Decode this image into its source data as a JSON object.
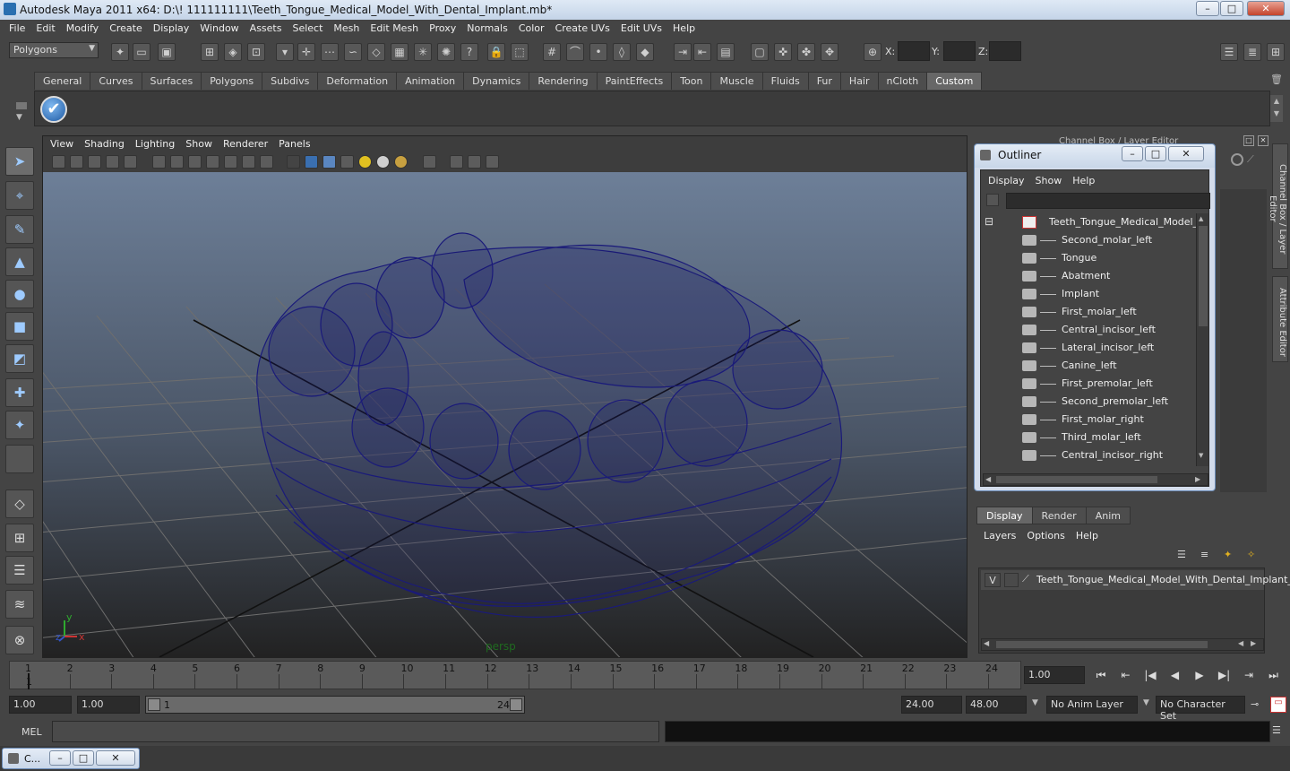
{
  "window": {
    "title": "Autodesk Maya 2011 x64: D:\\! 111111111\\Teeth_Tongue_Medical_Model_With_Dental_Implant.mb*",
    "minimize": "–",
    "maximize": "□",
    "close": "✕"
  },
  "menus": [
    "File",
    "Edit",
    "Modify",
    "Create",
    "Display",
    "Window",
    "Assets",
    "Select",
    "Mesh",
    "Edit Mesh",
    "Proxy",
    "Normals",
    "Color",
    "Create UVs",
    "Edit UVs",
    "Help"
  ],
  "status_line": {
    "mode": "Polygons",
    "x_label": "X:",
    "y_label": "Y:",
    "z_label": "Z:"
  },
  "shelf": {
    "tabs": [
      "General",
      "Curves",
      "Surfaces",
      "Polygons",
      "Subdivs",
      "Deformation",
      "Animation",
      "Dynamics",
      "Rendering",
      "PaintEffects",
      "Toon",
      "Muscle",
      "Fluids",
      "Fur",
      "Hair",
      "nCloth",
      "Custom"
    ],
    "active_tab": "Custom",
    "check_icon": "✔"
  },
  "viewport": {
    "menus": [
      "View",
      "Shading",
      "Lighting",
      "Show",
      "Renderer",
      "Panels"
    ],
    "camera_label": "persp",
    "axis_x": "x",
    "axis_y": "y",
    "axis_z": "z",
    "wire_color": "#1a1a7a"
  },
  "channel_box": {
    "title": "Channel Box / Layer Editor",
    "side_tab_1": "Channel Box / Layer Editor",
    "side_tab_2": "Attribute Editor"
  },
  "outliner": {
    "title": "Outliner",
    "menus": [
      "Display",
      "Show",
      "Help"
    ],
    "root": "Teeth_Tongue_Medical_Model_Wit",
    "collapse_symbol": "⊟",
    "items": [
      "Second_molar_left",
      "Tongue",
      "Abatment",
      "Implant",
      "First_molar_left",
      "Central_incisor_left",
      "Lateral_incisor_left",
      "Canine_left",
      "First_premolar_left",
      "Second_premolar_left",
      "First_molar_right",
      "Third_molar_left",
      "Central_incisor_right"
    ]
  },
  "layer_editor": {
    "tabs": [
      "Display",
      "Render",
      "Anim"
    ],
    "active_tab": "Display",
    "menus": [
      "Layers",
      "Options",
      "Help"
    ],
    "layer_visible": "V",
    "layer_name": "Teeth_Tongue_Medical_Model_With_Dental_Implant_"
  },
  "time_slider": {
    "ticks": [
      "1",
      "2",
      "3",
      "4",
      "5",
      "6",
      "7",
      "8",
      "9",
      "10",
      "11",
      "12",
      "13",
      "14",
      "15",
      "16",
      "17",
      "18",
      "19",
      "20",
      "21",
      "22",
      "23",
      "24"
    ],
    "current_frame": "1",
    "current_time": "1.00"
  },
  "playback": {
    "buttons": [
      "⏮",
      "⇤",
      "|◀",
      "◀",
      "▶",
      "▶|",
      "⇥",
      "⏭"
    ]
  },
  "range": {
    "start": "1.00",
    "current": "1.00",
    "bar_start": "1",
    "bar_end": "24",
    "end": "24.00",
    "total_end": "48.00",
    "anim_layer": "No Anim Layer",
    "character_set": "No Character Set"
  },
  "command_line": {
    "label": "MEL"
  },
  "taskbar": {
    "item": "C..."
  }
}
